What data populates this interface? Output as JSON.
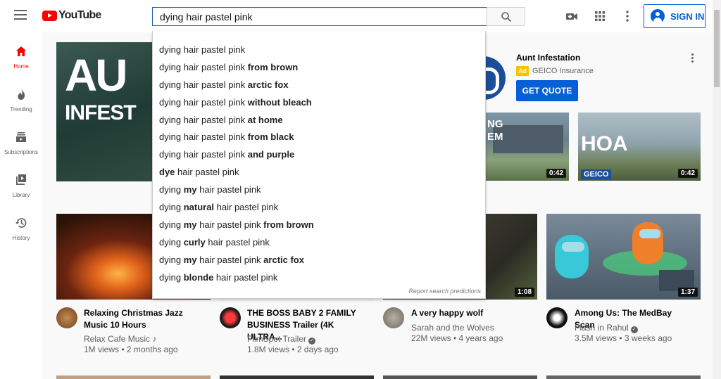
{
  "header": {
    "logo_text": "YouTube",
    "search_value": "dying hair pastel pink",
    "signin_label": "SIGN IN"
  },
  "sidebar": {
    "items": [
      {
        "label": "Home",
        "icon": "home-icon"
      },
      {
        "label": "Trending",
        "icon": "fire-icon"
      },
      {
        "label": "Subscriptions",
        "icon": "subscriptions-icon"
      },
      {
        "label": "Library",
        "icon": "library-icon"
      },
      {
        "label": "History",
        "icon": "history-icon"
      }
    ]
  },
  "suggestions": [
    {
      "plain": "dying hair pastel pink",
      "bold": ""
    },
    {
      "plain": "dying hair pastel pink ",
      "bold": "from brown"
    },
    {
      "plain": "dying hair pastel pink ",
      "bold": "arctic fox"
    },
    {
      "plain": "dying hair pastel pink ",
      "bold": "without bleach"
    },
    {
      "plain": "dying hair pastel pink ",
      "bold": "at home"
    },
    {
      "plain": "dying hair pastel pink ",
      "bold": "from black"
    },
    {
      "plain": "dying hair pastel pink ",
      "bold": "and purple"
    }
  ],
  "suggestions_mixed": [
    {
      "pre": "",
      "b1": "dye",
      "mid": " hair pastel pink",
      "b2": ""
    },
    {
      "pre": "dying ",
      "b1": "my",
      "mid": " hair pastel pink",
      "b2": ""
    },
    {
      "pre": "dying ",
      "b1": "natural",
      "mid": " hair pastel pink",
      "b2": ""
    },
    {
      "pre": "dying ",
      "b1": "my",
      "mid": " hair pastel pink ",
      "b2": "from brown"
    },
    {
      "pre": "dying ",
      "b1": "curly",
      "mid": " hair pastel pink",
      "b2": ""
    },
    {
      "pre": "dying ",
      "b1": "my",
      "mid": " hair pastel pink ",
      "b2": "arctic fox"
    },
    {
      "pre": "dying ",
      "b1": "blonde",
      "mid": " hair pastel pink",
      "b2": ""
    }
  ],
  "report_label": "Report search predictions",
  "ad": {
    "thumb_line1": "AU",
    "thumb_line2": "INFEST",
    "title": "Aunt Infestation",
    "badge": "Ad",
    "sponsor": "GEICO Insurance",
    "cta": "GET QUOTE",
    "video1": {
      "text1": "NG",
      "text2": "EM",
      "duration": "0:42"
    },
    "video2": {
      "text": "HOA",
      "brand": "GEICO",
      "duration": "0:42"
    }
  },
  "videos": [
    {
      "title": "Relaxing Christmas Jazz Music 10 Hours",
      "channel": "Relax Cafe Music",
      "channel_mark": "♪",
      "stats": "1M views • 2 months ago",
      "duration": ""
    },
    {
      "title": "THE BOSS BABY 2 FAMILY BUSINESS Trailer (4K ULTRA...",
      "channel": "FilmSpot Trailer",
      "channel_mark": "✓",
      "stats": "1.8M views • 2 days ago",
      "duration": ""
    },
    {
      "title": "A very happy wolf",
      "channel": "Sarah and the Wolves",
      "channel_mark": "",
      "stats": "22M views • 4 years ago",
      "duration": "1:08"
    },
    {
      "title": "Among Us: The MedBay Scan",
      "channel": "Flash in Rahul",
      "channel_mark": "✓",
      "stats": "3.5M views • 3 weeks ago",
      "duration": "1:37"
    }
  ],
  "colors": {
    "brand_red": "#ff0000",
    "link_blue": "#065fd4",
    "ad_badge": "#ffbf00"
  }
}
